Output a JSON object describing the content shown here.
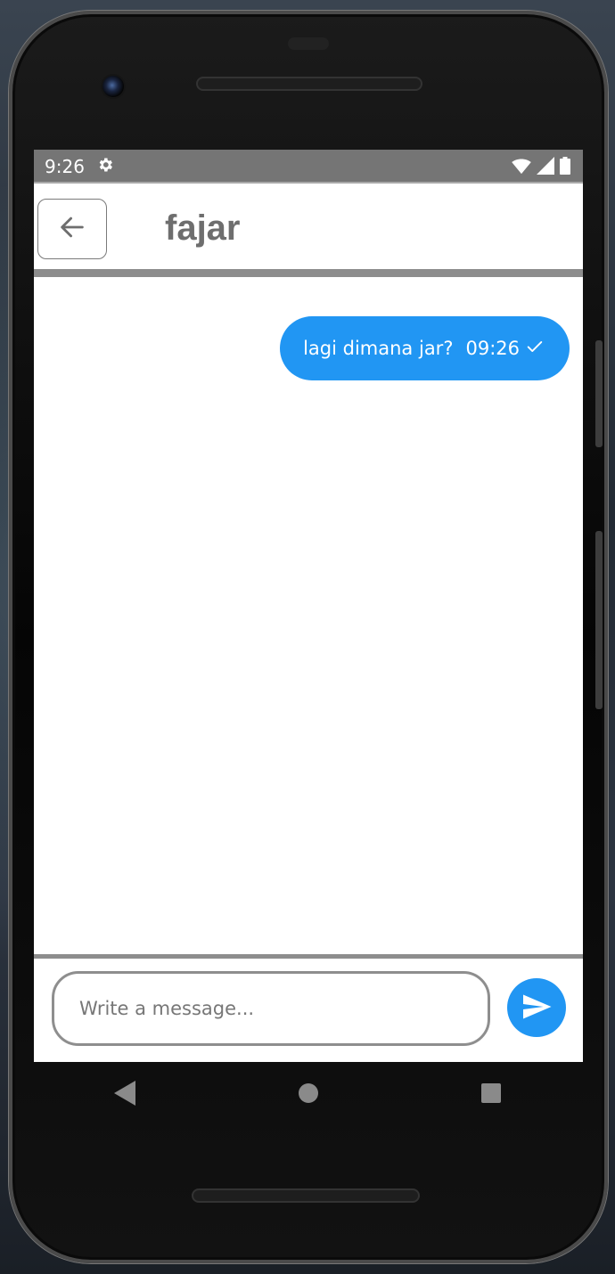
{
  "status_bar": {
    "time": "9:26",
    "icons": [
      "gear-icon",
      "wifi-icon",
      "signal-icon",
      "battery-icon"
    ]
  },
  "header": {
    "back_icon": "arrow-left-icon",
    "title": "fajar"
  },
  "messages": [
    {
      "text": "lagi dimana jar?",
      "time": "09:26",
      "status_icon": "check-icon",
      "direction": "outgoing"
    }
  ],
  "composer": {
    "placeholder": "Write a message...",
    "value": "",
    "send_icon": "send-icon"
  },
  "nav_bar": {
    "items": [
      "back-triangle-icon",
      "home-circle-icon",
      "recents-square-icon"
    ]
  },
  "colors": {
    "accent": "#2196f3",
    "status_bar": "#757575",
    "divider": "#8d8d8d",
    "title": "#6e6e6e"
  }
}
